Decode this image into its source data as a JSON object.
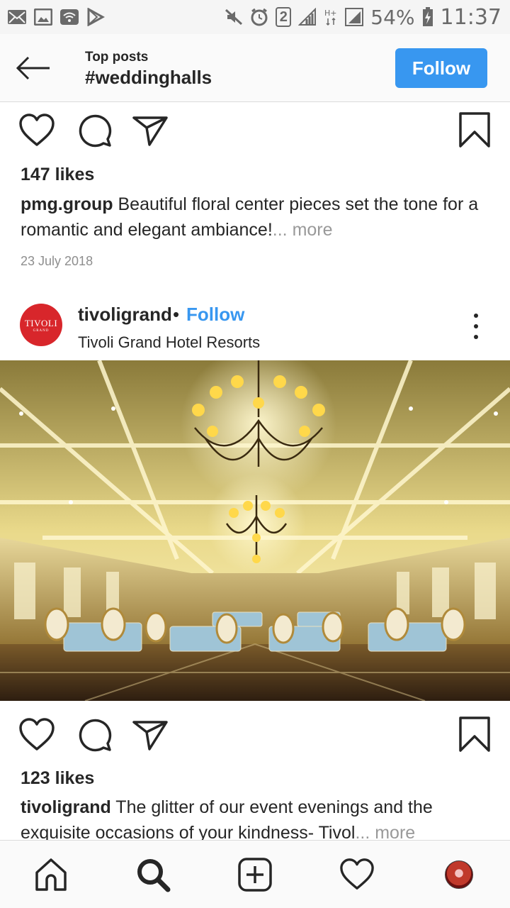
{
  "status_bar": {
    "battery": "54%",
    "time": "11:37",
    "notification_count": "2"
  },
  "header": {
    "subtitle": "Top posts",
    "title": "#weddinghalls",
    "follow_label": "Follow"
  },
  "post1": {
    "likes": "147 likes",
    "username": "pmg.group",
    "caption": "Beautiful floral center pieces set the tone for a romantic and elegant ambiance!",
    "more_label": "... more",
    "date": "23 July 2018"
  },
  "post2": {
    "username": "tivoligrand",
    "separator": "•",
    "follow_label": "Follow",
    "location": "Tivoli Grand Hotel Resorts",
    "avatar_text": "TIVOLI",
    "avatar_subtext": "GRAND",
    "likes": "123 likes",
    "caption": "The glitter of our event evenings and the exquisite occasions of your kindness- Tivol",
    "more_label": "... more"
  },
  "bottom_nav": [
    "home-icon",
    "search-icon",
    "add-post-icon",
    "activity-heart-icon",
    "profile-avatar"
  ],
  "colors": {
    "accent": "#3897f0",
    "avatar_red": "#d8262b",
    "muted_text": "#8e8e8e"
  }
}
